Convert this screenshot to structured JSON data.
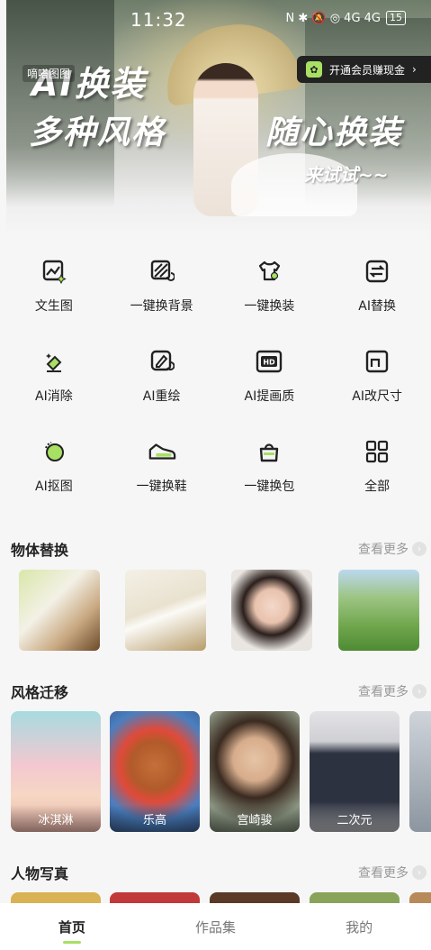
{
  "status_bar": {
    "time": "11:32",
    "icons": "N ✱ 🔕 ◎ 4G 4G",
    "battery": "15"
  },
  "banner": {
    "brand": "嘀嗒图图",
    "title": "AI换装",
    "subtitle_left": "多种风格",
    "subtitle_right": "随心换装",
    "cta": "来试试~~",
    "vip_label": "开通会员赚现金",
    "vip_arrow": "›"
  },
  "tools": [
    {
      "label": "文生图",
      "icon": "text-to-image-icon"
    },
    {
      "label": "一键换背景",
      "icon": "background-swap-icon"
    },
    {
      "label": "一键换装",
      "icon": "outfit-swap-icon"
    },
    {
      "label": "AI替换",
      "icon": "replace-icon"
    },
    {
      "label": "AI消除",
      "icon": "eraser-icon"
    },
    {
      "label": "AI重绘",
      "icon": "redraw-icon"
    },
    {
      "label": "AI提画质",
      "icon": "hd-icon"
    },
    {
      "label": "AI改尺寸",
      "icon": "resize-icon"
    },
    {
      "label": "AI抠图",
      "icon": "cutout-icon"
    },
    {
      "label": "一键换鞋",
      "icon": "shoe-icon"
    },
    {
      "label": "一键换包",
      "icon": "bag-icon"
    },
    {
      "label": "全部",
      "icon": "grid-icon"
    }
  ],
  "sections": {
    "object_replace": {
      "title": "物体替换",
      "more": "查看更多"
    },
    "style_transfer": {
      "title": "风格迁移",
      "more": "查看更多"
    },
    "portrait": {
      "title": "人物写真",
      "more": "查看更多"
    }
  },
  "style_cards": [
    {
      "caption": "冰淇淋"
    },
    {
      "caption": "乐高"
    },
    {
      "caption": "宫崎骏"
    },
    {
      "caption": "二次元"
    }
  ],
  "bottom_nav": [
    {
      "label": "首页",
      "active": true
    },
    {
      "label": "作品集",
      "active": false
    },
    {
      "label": "我的",
      "active": false
    }
  ],
  "colors": {
    "accent": "#a8e063",
    "text": "#222222",
    "muted": "#999999",
    "background": "#f6f6f6"
  }
}
